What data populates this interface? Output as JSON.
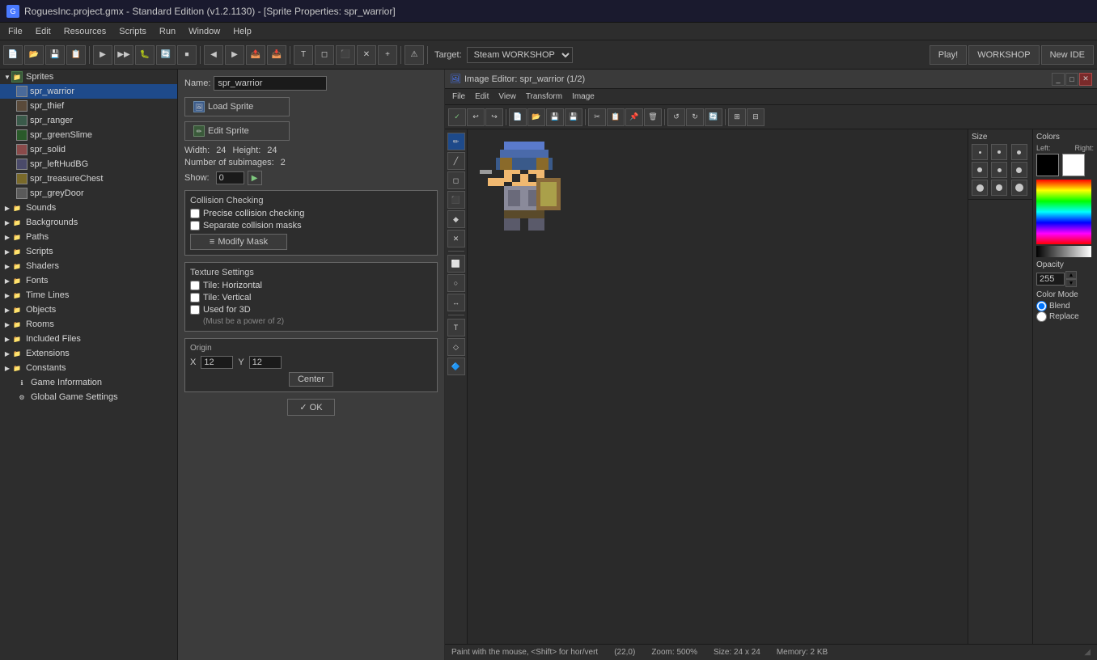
{
  "title_bar": {
    "title": "RoguesInc.project.gmx  -  Standard Edition (v1.2.1130) - [Sprite Properties: spr_warrior]",
    "icon": "GM"
  },
  "menu_bar": {
    "items": [
      "File",
      "Edit",
      "Resources",
      "Scripts",
      "Run",
      "Window",
      "Help"
    ]
  },
  "toolbar": {
    "target_label": "Target:",
    "target_value": "Steam WORKSHOP",
    "play_label": "Play!",
    "workshop_label": "WORKSHOP",
    "new_ide_label": "New IDE"
  },
  "sidebar": {
    "sprites_label": "Sprites",
    "sprites": [
      {
        "name": "spr_warrior",
        "selected": true
      },
      {
        "name": "spr_thief",
        "selected": false
      },
      {
        "name": "spr_ranger",
        "selected": false
      },
      {
        "name": "spr_greenSlime",
        "selected": false
      },
      {
        "name": "spr_solid",
        "selected": false
      },
      {
        "name": "spr_leftHudBG",
        "selected": false
      },
      {
        "name": "spr_treasureChest",
        "selected": false
      },
      {
        "name": "spr_greyDoor",
        "selected": false
      }
    ],
    "sounds_label": "Sounds",
    "backgrounds_label": "Backgrounds",
    "paths_label": "Paths",
    "scripts_label": "Scripts",
    "shaders_label": "Shaders",
    "fonts_label": "Fonts",
    "time_lines_label": "Time Lines",
    "objects_label": "Objects",
    "rooms_label": "Rooms",
    "included_files_label": "Included Files",
    "extensions_label": "Extensions",
    "constants_label": "Constants",
    "game_info_label": "Game Information",
    "global_settings_label": "Global Game Settings"
  },
  "sprite_props": {
    "name_label": "Name:",
    "name_value": "spr_warrior",
    "load_sprite_label": "Load Sprite",
    "edit_sprite_label": "Edit Sprite",
    "width_label": "Width:",
    "width_value": "24",
    "height_label": "Height:",
    "height_value": "24",
    "subimages_label": "Number of subimages:",
    "subimages_value": "2",
    "show_label": "Show:",
    "show_value": "0",
    "collision_section": "Collision Checking",
    "precise_collision_label": "Precise collision checking",
    "separate_masks_label": "Separate collision masks",
    "modify_mask_label": "Modify Mask",
    "texture_section": "Texture Settings",
    "tile_horizontal_label": "Tile: Horizontal",
    "tile_vertical_label": "Tile: Vertical",
    "used_for_3d_label": "Used for 3D",
    "power_of_2_label": "(Must be a power of 2)",
    "origin_section": "Origin",
    "origin_x_label": "X",
    "origin_x_value": "12",
    "origin_y_label": "Y",
    "origin_y_value": "12",
    "center_label": "Center",
    "ok_label": "✓ OK"
  },
  "image_editor": {
    "title": "Image Editor: spr_warrior (1/2)",
    "menu_items": [
      "File",
      "Edit",
      "View",
      "Transform",
      "Image"
    ],
    "status_paint": "Paint with the mouse, <Shift> for hor/vert",
    "coords": "(22,0)",
    "zoom": "Zoom: 500%",
    "size": "Size: 24 x 24",
    "memory": "Memory: 2 KB",
    "colors_title": "Colors",
    "left_label": "Left:",
    "right_label": "Right:",
    "opacity_label": "Opacity",
    "opacity_value": "255",
    "color_mode_label": "Color Mode",
    "blend_label": "Blend",
    "replace_label": "Replace",
    "size_label": "Size"
  },
  "colors": {
    "accent_blue": "#4a7aff",
    "bg_dark": "#2d2d2d",
    "bg_medium": "#3c3c3c",
    "border": "#555555",
    "text_main": "#d4d4d4",
    "selected_bg": "#1e4a8a",
    "green_check": "#7ec87e"
  }
}
